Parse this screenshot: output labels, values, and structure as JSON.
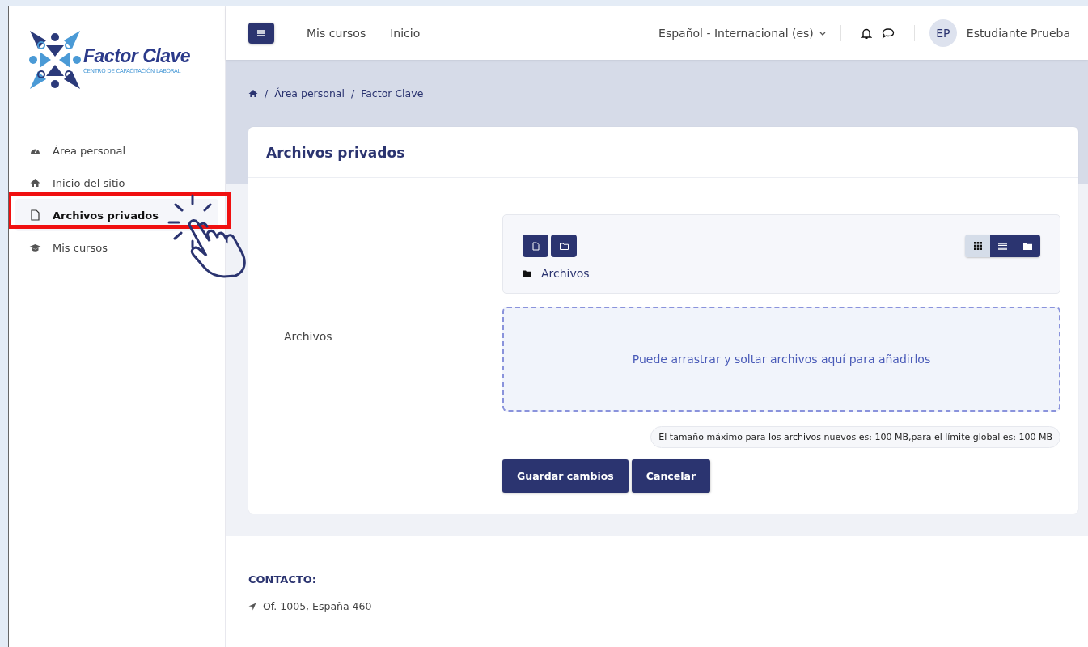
{
  "sidebar": {
    "logo": {
      "name": "Factor Clave",
      "tagline": "CENTRO DE CAPACITACIÓN LABORAL"
    },
    "items": [
      {
        "label": "Área personal",
        "kind": "dashboard",
        "selected": false
      },
      {
        "label": "Inicio del sitio",
        "kind": "home",
        "selected": false
      },
      {
        "label": "Archivos privados",
        "kind": "file",
        "selected": true
      },
      {
        "label": "Mis cursos",
        "kind": "courses",
        "selected": false
      }
    ]
  },
  "navbar": {
    "links": [
      "Mis cursos",
      "Inicio"
    ],
    "language": "Español - Internacional (es)",
    "user_initials": "EP",
    "user_name": "Estudiante Prueba"
  },
  "breadcrumb": [
    {
      "separator": "/",
      "text": "Área personal"
    },
    {
      "separator": "/",
      "text": "Factor Clave"
    }
  ],
  "card": {
    "title": "Archivos privados",
    "field_label": "Archivos",
    "path": "Archivos",
    "views": [
      {
        "kind": "icons",
        "selected": true
      },
      {
        "kind": "list",
        "selected": false
      },
      {
        "kind": "tree",
        "selected": false
      }
    ],
    "dropzone": "Puede arrastrar y soltar archivos aquí para añadirlos",
    "size_note": "El tamaño máximo para los archivos nuevos es: 100 MB,para el límite global es: 100 MB",
    "buttons": [
      "Guardar cambios",
      "Cancelar"
    ]
  },
  "footer": {
    "heading": "CONTACTO:",
    "address": "Of. 1005, España 460"
  }
}
